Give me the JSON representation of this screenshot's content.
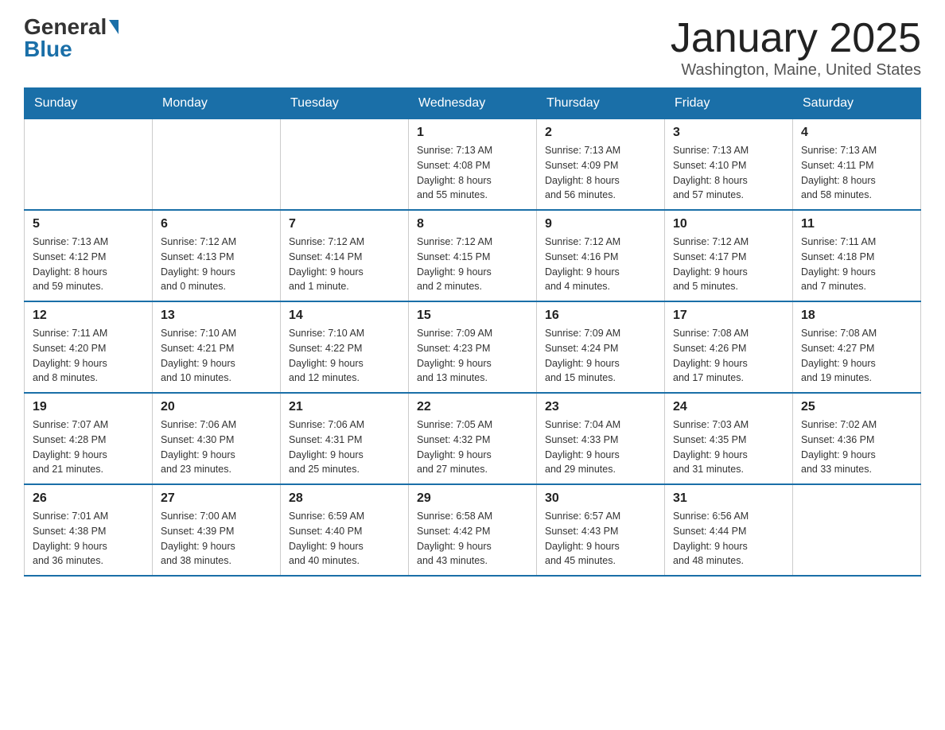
{
  "logo": {
    "general": "General",
    "blue": "Blue"
  },
  "title": {
    "month_year": "January 2025",
    "location": "Washington, Maine, United States"
  },
  "header": {
    "days": [
      "Sunday",
      "Monday",
      "Tuesday",
      "Wednesday",
      "Thursday",
      "Friday",
      "Saturday"
    ]
  },
  "weeks": [
    {
      "days": [
        {
          "number": "",
          "info": ""
        },
        {
          "number": "",
          "info": ""
        },
        {
          "number": "",
          "info": ""
        },
        {
          "number": "1",
          "info": "Sunrise: 7:13 AM\nSunset: 4:08 PM\nDaylight: 8 hours\nand 55 minutes."
        },
        {
          "number": "2",
          "info": "Sunrise: 7:13 AM\nSunset: 4:09 PM\nDaylight: 8 hours\nand 56 minutes."
        },
        {
          "number": "3",
          "info": "Sunrise: 7:13 AM\nSunset: 4:10 PM\nDaylight: 8 hours\nand 57 minutes."
        },
        {
          "number": "4",
          "info": "Sunrise: 7:13 AM\nSunset: 4:11 PM\nDaylight: 8 hours\nand 58 minutes."
        }
      ]
    },
    {
      "days": [
        {
          "number": "5",
          "info": "Sunrise: 7:13 AM\nSunset: 4:12 PM\nDaylight: 8 hours\nand 59 minutes."
        },
        {
          "number": "6",
          "info": "Sunrise: 7:12 AM\nSunset: 4:13 PM\nDaylight: 9 hours\nand 0 minutes."
        },
        {
          "number": "7",
          "info": "Sunrise: 7:12 AM\nSunset: 4:14 PM\nDaylight: 9 hours\nand 1 minute."
        },
        {
          "number": "8",
          "info": "Sunrise: 7:12 AM\nSunset: 4:15 PM\nDaylight: 9 hours\nand 2 minutes."
        },
        {
          "number": "9",
          "info": "Sunrise: 7:12 AM\nSunset: 4:16 PM\nDaylight: 9 hours\nand 4 minutes."
        },
        {
          "number": "10",
          "info": "Sunrise: 7:12 AM\nSunset: 4:17 PM\nDaylight: 9 hours\nand 5 minutes."
        },
        {
          "number": "11",
          "info": "Sunrise: 7:11 AM\nSunset: 4:18 PM\nDaylight: 9 hours\nand 7 minutes."
        }
      ]
    },
    {
      "days": [
        {
          "number": "12",
          "info": "Sunrise: 7:11 AM\nSunset: 4:20 PM\nDaylight: 9 hours\nand 8 minutes."
        },
        {
          "number": "13",
          "info": "Sunrise: 7:10 AM\nSunset: 4:21 PM\nDaylight: 9 hours\nand 10 minutes."
        },
        {
          "number": "14",
          "info": "Sunrise: 7:10 AM\nSunset: 4:22 PM\nDaylight: 9 hours\nand 12 minutes."
        },
        {
          "number": "15",
          "info": "Sunrise: 7:09 AM\nSunset: 4:23 PM\nDaylight: 9 hours\nand 13 minutes."
        },
        {
          "number": "16",
          "info": "Sunrise: 7:09 AM\nSunset: 4:24 PM\nDaylight: 9 hours\nand 15 minutes."
        },
        {
          "number": "17",
          "info": "Sunrise: 7:08 AM\nSunset: 4:26 PM\nDaylight: 9 hours\nand 17 minutes."
        },
        {
          "number": "18",
          "info": "Sunrise: 7:08 AM\nSunset: 4:27 PM\nDaylight: 9 hours\nand 19 minutes."
        }
      ]
    },
    {
      "days": [
        {
          "number": "19",
          "info": "Sunrise: 7:07 AM\nSunset: 4:28 PM\nDaylight: 9 hours\nand 21 minutes."
        },
        {
          "number": "20",
          "info": "Sunrise: 7:06 AM\nSunset: 4:30 PM\nDaylight: 9 hours\nand 23 minutes."
        },
        {
          "number": "21",
          "info": "Sunrise: 7:06 AM\nSunset: 4:31 PM\nDaylight: 9 hours\nand 25 minutes."
        },
        {
          "number": "22",
          "info": "Sunrise: 7:05 AM\nSunset: 4:32 PM\nDaylight: 9 hours\nand 27 minutes."
        },
        {
          "number": "23",
          "info": "Sunrise: 7:04 AM\nSunset: 4:33 PM\nDaylight: 9 hours\nand 29 minutes."
        },
        {
          "number": "24",
          "info": "Sunrise: 7:03 AM\nSunset: 4:35 PM\nDaylight: 9 hours\nand 31 minutes."
        },
        {
          "number": "25",
          "info": "Sunrise: 7:02 AM\nSunset: 4:36 PM\nDaylight: 9 hours\nand 33 minutes."
        }
      ]
    },
    {
      "days": [
        {
          "number": "26",
          "info": "Sunrise: 7:01 AM\nSunset: 4:38 PM\nDaylight: 9 hours\nand 36 minutes."
        },
        {
          "number": "27",
          "info": "Sunrise: 7:00 AM\nSunset: 4:39 PM\nDaylight: 9 hours\nand 38 minutes."
        },
        {
          "number": "28",
          "info": "Sunrise: 6:59 AM\nSunset: 4:40 PM\nDaylight: 9 hours\nand 40 minutes."
        },
        {
          "number": "29",
          "info": "Sunrise: 6:58 AM\nSunset: 4:42 PM\nDaylight: 9 hours\nand 43 minutes."
        },
        {
          "number": "30",
          "info": "Sunrise: 6:57 AM\nSunset: 4:43 PM\nDaylight: 9 hours\nand 45 minutes."
        },
        {
          "number": "31",
          "info": "Sunrise: 6:56 AM\nSunset: 4:44 PM\nDaylight: 9 hours\nand 48 minutes."
        },
        {
          "number": "",
          "info": ""
        }
      ]
    }
  ]
}
